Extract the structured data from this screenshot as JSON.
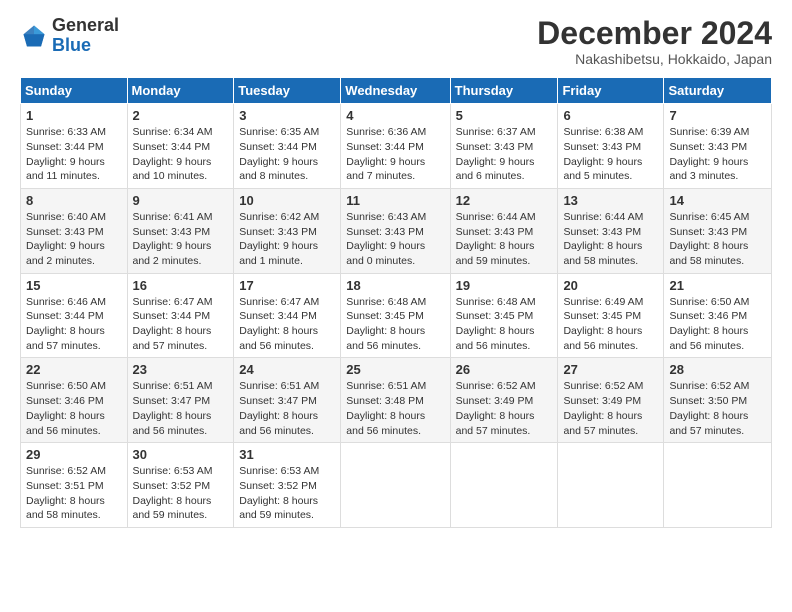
{
  "header": {
    "logo_general": "General",
    "logo_blue": "Blue",
    "title": "December 2024",
    "location": "Nakashibetsu, Hokkaido, Japan"
  },
  "weekdays": [
    "Sunday",
    "Monday",
    "Tuesday",
    "Wednesday",
    "Thursday",
    "Friday",
    "Saturday"
  ],
  "weeks": [
    [
      {
        "day": "1",
        "info": "Sunrise: 6:33 AM\nSunset: 3:44 PM\nDaylight: 9 hours\nand 11 minutes."
      },
      {
        "day": "2",
        "info": "Sunrise: 6:34 AM\nSunset: 3:44 PM\nDaylight: 9 hours\nand 10 minutes."
      },
      {
        "day": "3",
        "info": "Sunrise: 6:35 AM\nSunset: 3:44 PM\nDaylight: 9 hours\nand 8 minutes."
      },
      {
        "day": "4",
        "info": "Sunrise: 6:36 AM\nSunset: 3:44 PM\nDaylight: 9 hours\nand 7 minutes."
      },
      {
        "day": "5",
        "info": "Sunrise: 6:37 AM\nSunset: 3:43 PM\nDaylight: 9 hours\nand 6 minutes."
      },
      {
        "day": "6",
        "info": "Sunrise: 6:38 AM\nSunset: 3:43 PM\nDaylight: 9 hours\nand 5 minutes."
      },
      {
        "day": "7",
        "info": "Sunrise: 6:39 AM\nSunset: 3:43 PM\nDaylight: 9 hours\nand 3 minutes."
      }
    ],
    [
      {
        "day": "8",
        "info": "Sunrise: 6:40 AM\nSunset: 3:43 PM\nDaylight: 9 hours\nand 2 minutes."
      },
      {
        "day": "9",
        "info": "Sunrise: 6:41 AM\nSunset: 3:43 PM\nDaylight: 9 hours\nand 2 minutes."
      },
      {
        "day": "10",
        "info": "Sunrise: 6:42 AM\nSunset: 3:43 PM\nDaylight: 9 hours\nand 1 minute."
      },
      {
        "day": "11",
        "info": "Sunrise: 6:43 AM\nSunset: 3:43 PM\nDaylight: 9 hours\nand 0 minutes."
      },
      {
        "day": "12",
        "info": "Sunrise: 6:44 AM\nSunset: 3:43 PM\nDaylight: 8 hours\nand 59 minutes."
      },
      {
        "day": "13",
        "info": "Sunrise: 6:44 AM\nSunset: 3:43 PM\nDaylight: 8 hours\nand 58 minutes."
      },
      {
        "day": "14",
        "info": "Sunrise: 6:45 AM\nSunset: 3:43 PM\nDaylight: 8 hours\nand 58 minutes."
      }
    ],
    [
      {
        "day": "15",
        "info": "Sunrise: 6:46 AM\nSunset: 3:44 PM\nDaylight: 8 hours\nand 57 minutes."
      },
      {
        "day": "16",
        "info": "Sunrise: 6:47 AM\nSunset: 3:44 PM\nDaylight: 8 hours\nand 57 minutes."
      },
      {
        "day": "17",
        "info": "Sunrise: 6:47 AM\nSunset: 3:44 PM\nDaylight: 8 hours\nand 56 minutes."
      },
      {
        "day": "18",
        "info": "Sunrise: 6:48 AM\nSunset: 3:45 PM\nDaylight: 8 hours\nand 56 minutes."
      },
      {
        "day": "19",
        "info": "Sunrise: 6:48 AM\nSunset: 3:45 PM\nDaylight: 8 hours\nand 56 minutes."
      },
      {
        "day": "20",
        "info": "Sunrise: 6:49 AM\nSunset: 3:45 PM\nDaylight: 8 hours\nand 56 minutes."
      },
      {
        "day": "21",
        "info": "Sunrise: 6:50 AM\nSunset: 3:46 PM\nDaylight: 8 hours\nand 56 minutes."
      }
    ],
    [
      {
        "day": "22",
        "info": "Sunrise: 6:50 AM\nSunset: 3:46 PM\nDaylight: 8 hours\nand 56 minutes."
      },
      {
        "day": "23",
        "info": "Sunrise: 6:51 AM\nSunset: 3:47 PM\nDaylight: 8 hours\nand 56 minutes."
      },
      {
        "day": "24",
        "info": "Sunrise: 6:51 AM\nSunset: 3:47 PM\nDaylight: 8 hours\nand 56 minutes."
      },
      {
        "day": "25",
        "info": "Sunrise: 6:51 AM\nSunset: 3:48 PM\nDaylight: 8 hours\nand 56 minutes."
      },
      {
        "day": "26",
        "info": "Sunrise: 6:52 AM\nSunset: 3:49 PM\nDaylight: 8 hours\nand 57 minutes."
      },
      {
        "day": "27",
        "info": "Sunrise: 6:52 AM\nSunset: 3:49 PM\nDaylight: 8 hours\nand 57 minutes."
      },
      {
        "day": "28",
        "info": "Sunrise: 6:52 AM\nSunset: 3:50 PM\nDaylight: 8 hours\nand 57 minutes."
      }
    ],
    [
      {
        "day": "29",
        "info": "Sunrise: 6:52 AM\nSunset: 3:51 PM\nDaylight: 8 hours\nand 58 minutes."
      },
      {
        "day": "30",
        "info": "Sunrise: 6:53 AM\nSunset: 3:52 PM\nDaylight: 8 hours\nand 59 minutes."
      },
      {
        "day": "31",
        "info": "Sunrise: 6:53 AM\nSunset: 3:52 PM\nDaylight: 8 hours\nand 59 minutes."
      },
      null,
      null,
      null,
      null
    ]
  ]
}
